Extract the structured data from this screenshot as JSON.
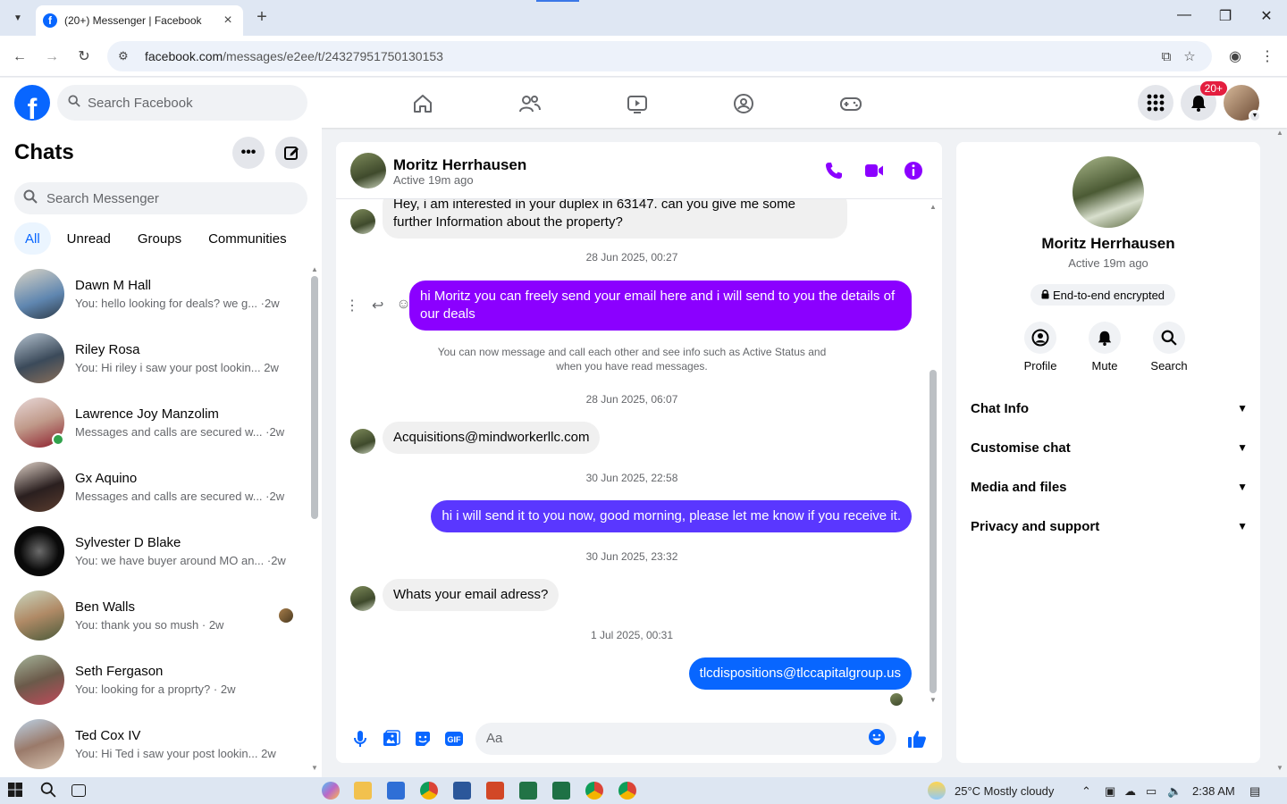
{
  "browser": {
    "tab_title": "(20+) Messenger | Facebook",
    "url_host": "facebook.com",
    "url_path": "/messages/e2ee/t/24327951750130153"
  },
  "fb_header": {
    "search_placeholder": "Search Facebook",
    "notification_badge": "20+"
  },
  "sidebar": {
    "title": "Chats",
    "search_placeholder": "Search Messenger",
    "filters": [
      "All",
      "Unread",
      "Groups",
      "Communities"
    ],
    "active_filter": "All",
    "chats": [
      {
        "name": "Dawn M Hall",
        "preview": "You: hello looking for deals? we g... ·2w"
      },
      {
        "name": "Riley Rosa",
        "preview": "You: Hi riley i saw your post lookin...  2w"
      },
      {
        "name": "Lawrence Joy Manzolim",
        "preview": "Messages and calls are secured w... ·2w",
        "online": true
      },
      {
        "name": "Gx Aquino",
        "preview": "Messages and calls are secured w... ·2w"
      },
      {
        "name": "Sylvester D Blake",
        "preview": "You: we have buyer around MO an... ·2w"
      },
      {
        "name": "Ben Walls",
        "preview": "You: thank you so mush · 2w"
      },
      {
        "name": "Seth Fergason",
        "preview": "You: looking for a proprty? · 2w"
      },
      {
        "name": "Ted Cox IV",
        "preview": "You: Hi Ted i saw your post lookin...  2w"
      }
    ]
  },
  "conversation": {
    "contact_name": "Moritz Herrhausen",
    "contact_status": "Active 19m ago",
    "messages": {
      "m1": "Hey, i am interested in your duplex in 63147. can you give me some further Information about the property?",
      "ts1": "28 Jun 2025, 00:27",
      "m2": "hi Moritz you can freely send your email here and i will send to you the details of our deals",
      "system_note": "You can now message and call each other and see info such as Active Status and when you have read messages.",
      "ts2": "28 Jun 2025, 06:07",
      "m3": "Acquisitions@mindworkerllc.com",
      "ts3": "30 Jun 2025, 22:58",
      "m4": "hi i will send it to you now, good morning, please let me know if you receive it.",
      "ts4": "30 Jun 2025, 23:32",
      "m5": "Whats your email adress?",
      "ts5": "1 Jul 2025, 00:31",
      "m6": "tlcdispositions@tlccapitalgroup.us"
    },
    "composer_placeholder": "Aa"
  },
  "info_panel": {
    "name": "Moritz Herrhausen",
    "status": "Active 19m ago",
    "encryption": "End-to-end encrypted",
    "actions": [
      "Profile",
      "Mute",
      "Search"
    ],
    "sections": [
      "Chat Info",
      "Customise chat",
      "Media and files",
      "Privacy and support"
    ]
  },
  "taskbar": {
    "weather": "25°C  Mostly cloudy",
    "time": "2:38 AM"
  },
  "colors": {
    "fb_blue": "#0866ff",
    "accent_purple": "#8b00ff",
    "badge_red": "#e41e3f"
  }
}
